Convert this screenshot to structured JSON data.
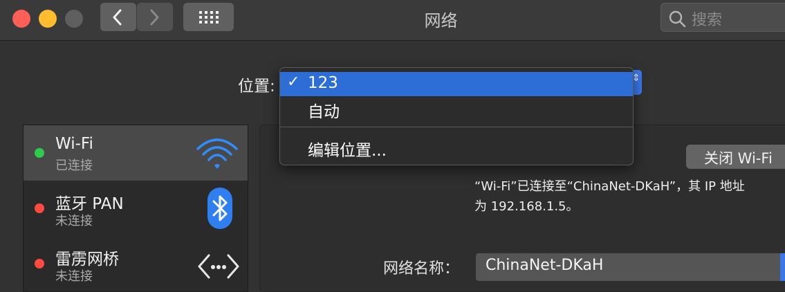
{
  "window": {
    "title": "网络"
  },
  "search": {
    "placeholder": "搜索"
  },
  "location": {
    "label": "位置:",
    "menu": {
      "items": [
        {
          "label": "123",
          "checked": true
        },
        {
          "label": "自动",
          "checked": false
        }
      ],
      "edit_label": "编辑位置...",
      "check_glyph": "✓"
    }
  },
  "sidebar": {
    "items": [
      {
        "name": "Wi-Fi",
        "status": "已连接",
        "status_color": "#2fcc4b",
        "icon": "wifi-icon"
      },
      {
        "name": "蓝牙 PAN",
        "status": "未连接",
        "status_color": "#fd4b3f",
        "icon": "bluetooth-icon"
      },
      {
        "name": "雷雳网桥",
        "status": "未连接",
        "status_color": "#fd4b3f",
        "icon": "thunderbolt-bridge-icon"
      }
    ]
  },
  "detail": {
    "wifi_off_button": "关闭 Wi-Fi",
    "status_line1": "“Wi-Fi”已连接至“ChinaNet-DKaH”，其 IP 地址",
    "status_line2": "为 192.168.1.5。",
    "network_name_label": "网络名称：",
    "network_name_value": "ChinaNet-DKaH"
  },
  "colors": {
    "accent": "#3b78e7",
    "connected": "#2fcc4b",
    "disconnected": "#fd4b3f"
  }
}
